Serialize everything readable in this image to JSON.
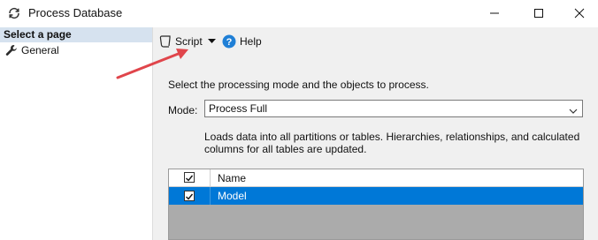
{
  "window": {
    "title": "Process Database",
    "icon": "refresh-cycle-icon"
  },
  "left_pane": {
    "header": "Select a page",
    "items": [
      {
        "label": "General",
        "icon": "wrench-icon"
      }
    ]
  },
  "toolbar": {
    "script_label": "Script",
    "help_label": "Help"
  },
  "main": {
    "instructions": "Select the processing mode and the objects to process.",
    "mode_label": "Mode:",
    "mode_value": "Process Full",
    "mode_description": "Loads data into all partitions or tables. Hierarchies, relationships, and calculated columns for all tables are updated."
  },
  "grid": {
    "header_name": "Name",
    "header_checked": true,
    "rows": [
      {
        "name": "Model",
        "checked": true,
        "selected": true
      }
    ]
  },
  "colors": {
    "selection": "#0078d7",
    "pane_header": "#d6e2ef",
    "annotation_arrow": "#e0454b",
    "help_icon": "#1f7fd6"
  }
}
